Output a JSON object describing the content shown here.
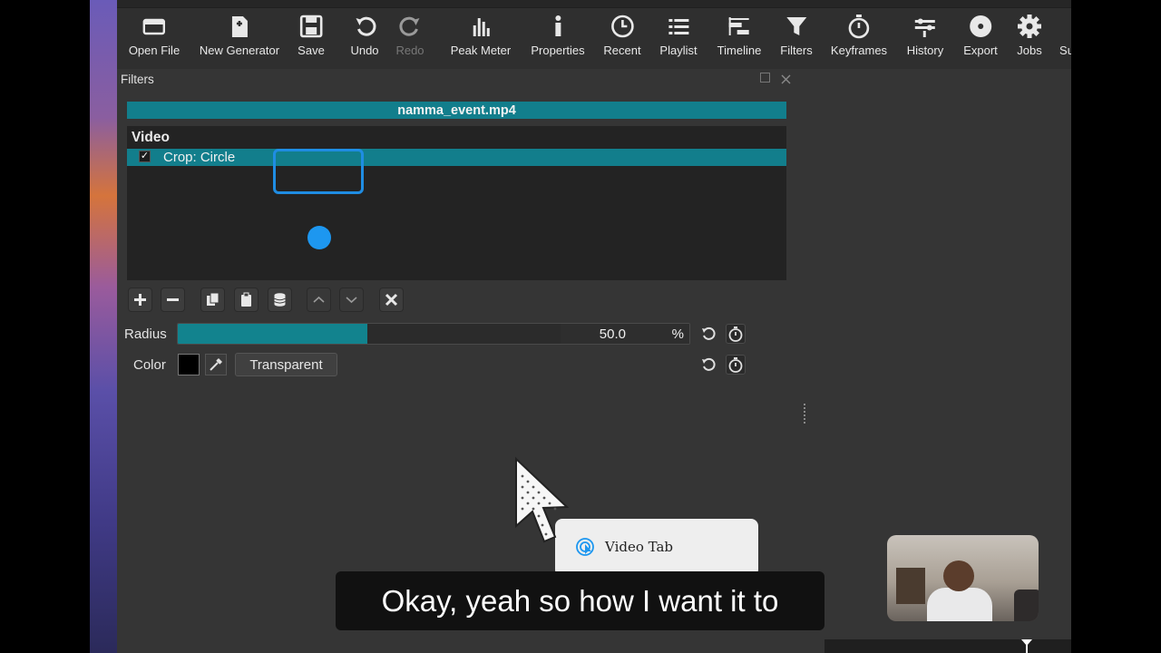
{
  "toolbar": {
    "items": [
      {
        "label": "Open File",
        "icon": "open-file-icon"
      },
      {
        "label": "New Generator",
        "icon": "new-generator-icon"
      },
      {
        "label": "Save",
        "icon": "save-icon"
      },
      {
        "label": "Undo",
        "icon": "undo-icon"
      },
      {
        "label": "Redo",
        "icon": "redo-icon",
        "disabled": true
      },
      {
        "label": "Peak Meter",
        "icon": "peak-meter-icon"
      },
      {
        "label": "Properties",
        "icon": "properties-icon"
      },
      {
        "label": "Recent",
        "icon": "recent-clock-icon"
      },
      {
        "label": "Playlist",
        "icon": "playlist-icon"
      },
      {
        "label": "Timeline",
        "icon": "timeline-icon"
      },
      {
        "label": "Filters",
        "icon": "filters-funnel-icon"
      },
      {
        "label": "Keyframes",
        "icon": "keyframes-stopwatch-icon"
      },
      {
        "label": "History",
        "icon": "history-icon"
      },
      {
        "label": "Export",
        "icon": "export-disc-icon"
      },
      {
        "label": "Jobs",
        "icon": "jobs-gear-icon"
      },
      {
        "label": "Su",
        "icon": "none"
      }
    ]
  },
  "filters_panel": {
    "title": "Filters",
    "clip_name": "namma_event.mp4",
    "section": "Video",
    "filter_item": {
      "label": "Crop: Circle",
      "checked": true,
      "check_glyph": "✓"
    },
    "params": {
      "radius": {
        "label": "Radius",
        "value": "50.0",
        "unit": "%",
        "fraction": 0.37
      },
      "color": {
        "label": "Color",
        "swatch": "#000000",
        "button_label": "Transparent"
      }
    }
  },
  "tooltip": {
    "label": "Video Tab"
  },
  "caption": {
    "text": "Okay, yeah so how I want it to"
  },
  "colors": {
    "accent": "#127e8c",
    "highlight": "#1f8de3",
    "panel": "#353535"
  }
}
